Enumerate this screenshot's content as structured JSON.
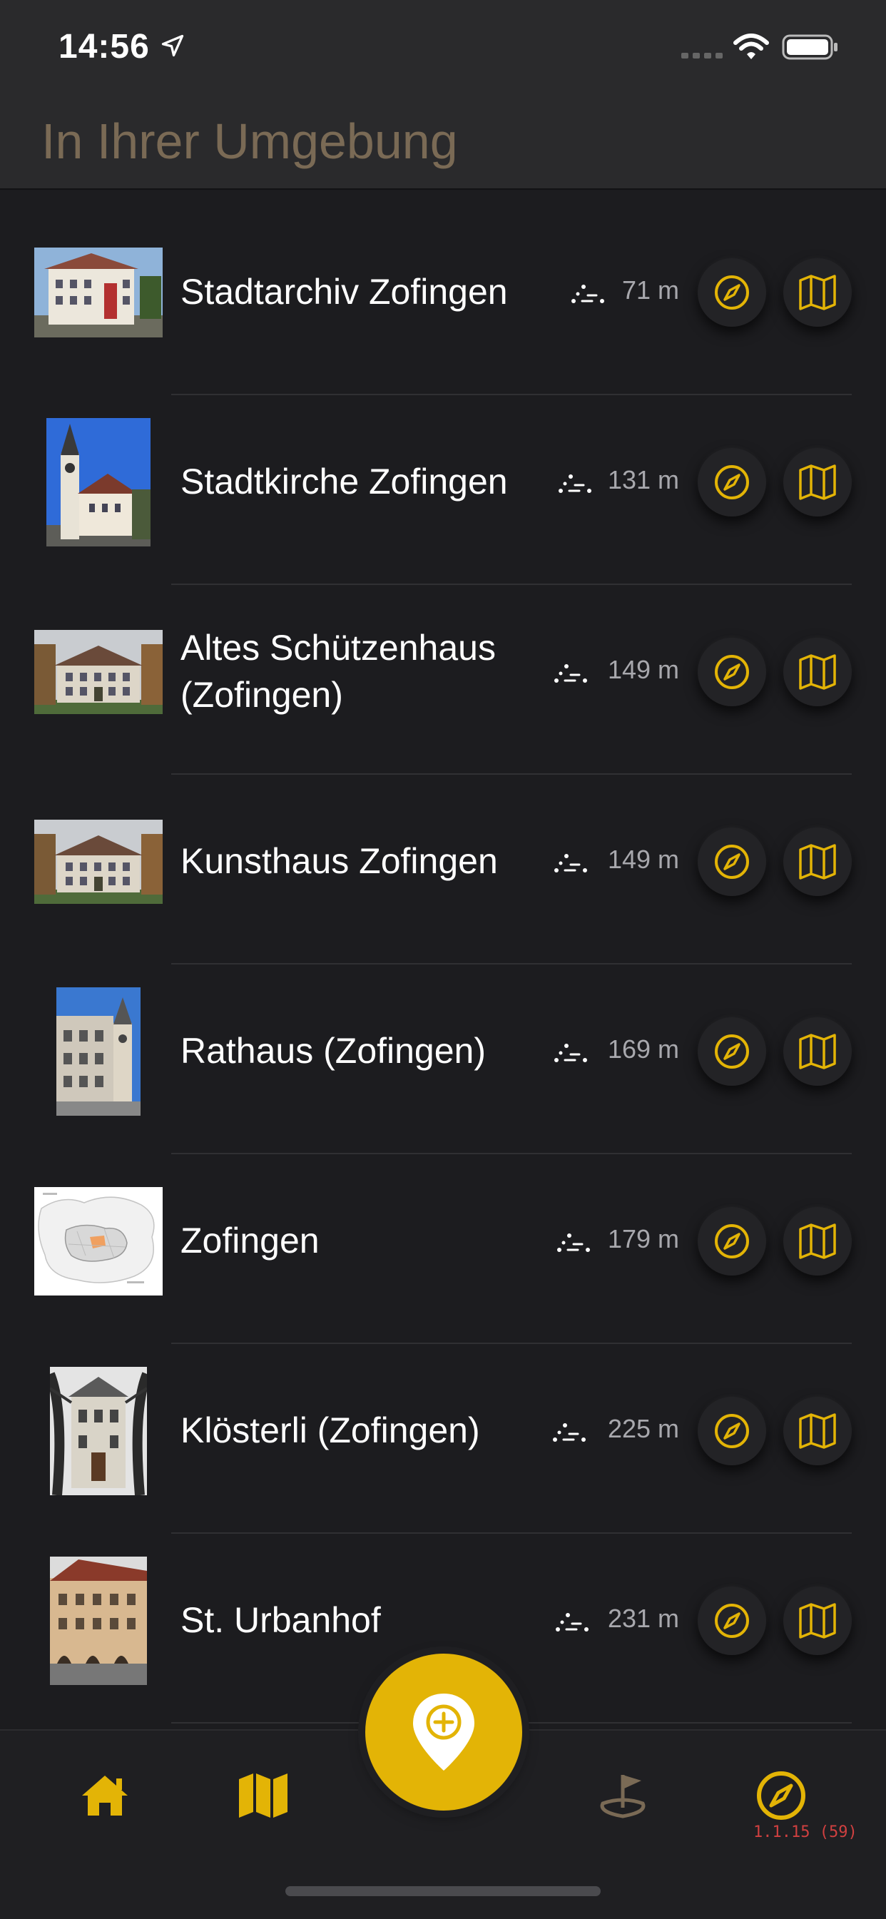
{
  "status_bar": {
    "time": "14:56"
  },
  "header": {
    "title": "In Ihrer Umgebung"
  },
  "colors": {
    "accent": "#e3b406",
    "background": "#1c1c1f",
    "title": "#7a6a55",
    "distance_text": "#a8a8ad",
    "version_text": "#d04040"
  },
  "places": [
    {
      "name": "Stadtarchiv Zofingen",
      "distance": "71 m",
      "thumb_kind": "house"
    },
    {
      "name": "Stadtkirche Zofingen",
      "distance": "131 m",
      "thumb_kind": "church"
    },
    {
      "name": "Altes Schützenhaus (Zofingen)",
      "distance": "149 m",
      "thumb_kind": "manor"
    },
    {
      "name": "Kunsthaus Zofingen",
      "distance": "149 m",
      "thumb_kind": "manor"
    },
    {
      "name": "Rathaus (Zofingen)",
      "distance": "169 m",
      "thumb_kind": "tower"
    },
    {
      "name": "Zofingen",
      "distance": "179 m",
      "thumb_kind": "map"
    },
    {
      "name": "Klösterli (Zofingen)",
      "distance": "225 m",
      "thumb_kind": "villa"
    },
    {
      "name": "St. Urbanhof",
      "distance": "231 m",
      "thumb_kind": "townhouse"
    }
  ],
  "row_icons": {
    "walk": "walking-distance-icon",
    "compass": "compass-icon",
    "map": "map-icon"
  },
  "tab_bar": {
    "tabs": [
      {
        "icon": "home-icon"
      },
      {
        "icon": "map-icon"
      },
      {
        "icon": "add-location-icon"
      },
      {
        "icon": "tour-flag-icon"
      },
      {
        "icon": "compass-icon"
      }
    ],
    "version": "1.1.15 (59)"
  }
}
